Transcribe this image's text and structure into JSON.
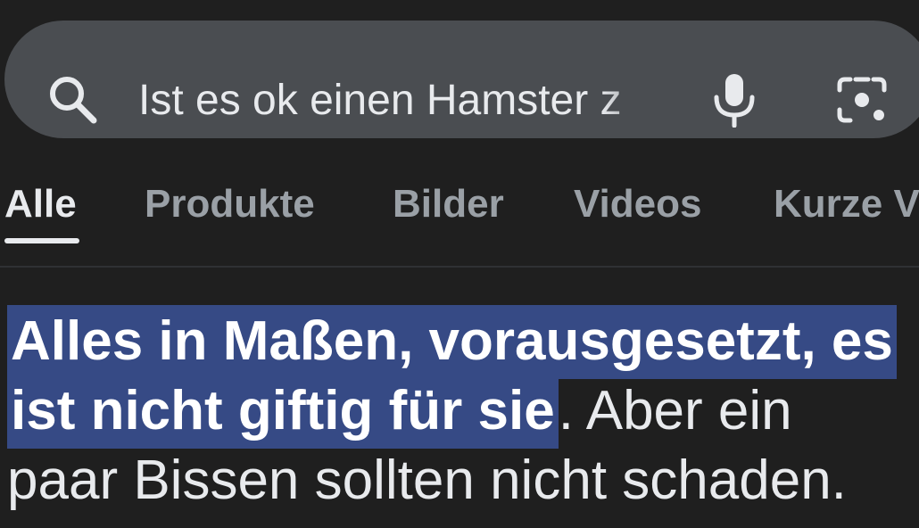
{
  "search": {
    "query": "Ist es ok einen Hamster z",
    "icons": {
      "search": "search-icon",
      "mic": "mic-icon",
      "lens": "camera-lens-icon"
    }
  },
  "tabs": [
    {
      "label": "Alle",
      "active": true
    },
    {
      "label": "Produkte",
      "active": false
    },
    {
      "label": "Bilder",
      "active": false
    },
    {
      "label": "Videos",
      "active": false
    },
    {
      "label": "Kurze V",
      "active": false
    }
  ],
  "answer": {
    "highlighted": "Alles in Maßen, vorausgesetzt, es ist nicht giftig für sie",
    "rest": ". Aber ein paar Bissen sollten nicht schaden."
  },
  "colors": {
    "background": "#1f1f1f",
    "search_bar": "#4a4d51",
    "highlight": "#364a85"
  }
}
